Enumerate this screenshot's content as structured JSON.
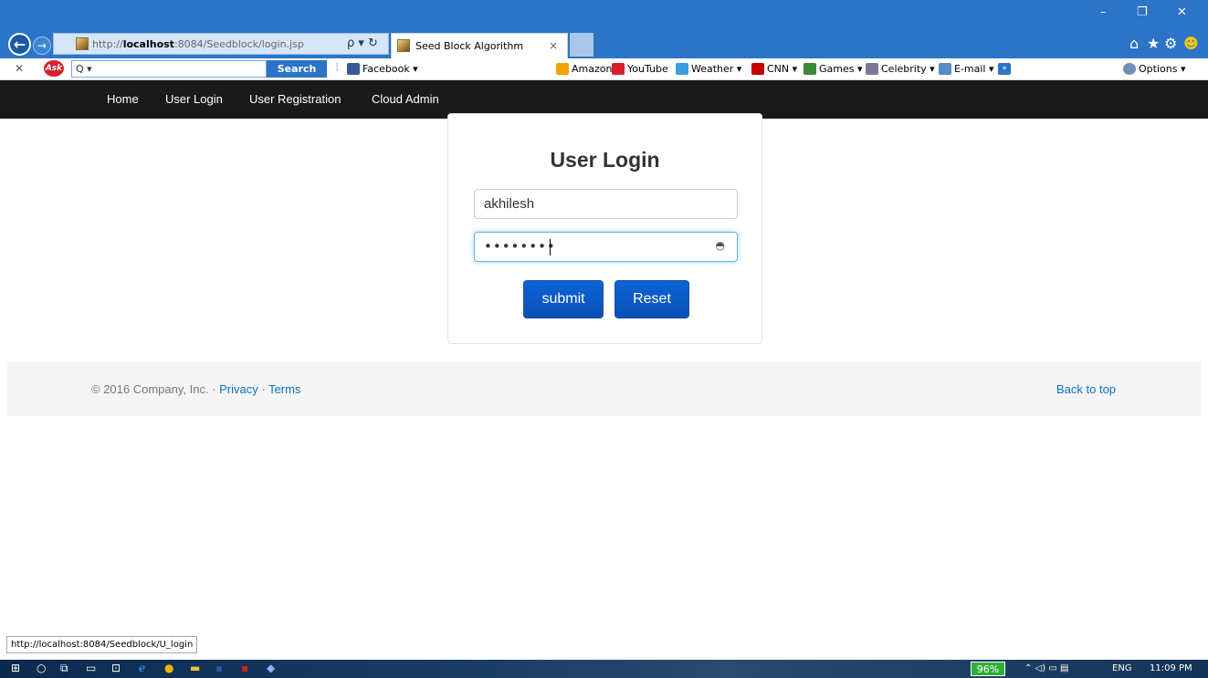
{
  "browser": {
    "url_prefix": "http://",
    "url_host": "localhost",
    "url_rest": ":8084/Seedblock/login.jsp",
    "tab_title": "Seed Block Algorithm",
    "addr_tools": "ρ ▾ ↻"
  },
  "toolbar": {
    "search_placeholder": "Q ▾",
    "search_button": "Search",
    "facebook": "Facebook ▾",
    "amazon": "Amazon",
    "youtube": "YouTube",
    "weather": "Weather ▾",
    "cnn": "CNN ▾",
    "games": "Games ▾",
    "celebrity": "Celebrity ▾",
    "email": "E-mail ▾",
    "options": "Options ▾"
  },
  "nav": {
    "home": "Home",
    "user_login": "User Login",
    "user_registration": "User Registration",
    "cloud_admin": "Cloud Admin"
  },
  "login": {
    "title": "User Login",
    "username_value": "akhilesh",
    "password_masked": "••••••••",
    "submit": "submit",
    "reset": "Reset"
  },
  "footer": {
    "copyright": "© 2016 Company, Inc. · ",
    "privacy": "Privacy",
    "dot": " · ",
    "terms": "Terms",
    "back_to_top": "Back to top"
  },
  "status_url": "http://localhost:8084/Seedblock/U_login",
  "taskbar": {
    "battery": "96%",
    "lang": "ENG",
    "time": "11:09 PM"
  },
  "colors": {
    "titlebar": "#2b74c7",
    "navbar": "#1a1a1a",
    "button": "#0a50b5",
    "link": "#0a70c2"
  }
}
